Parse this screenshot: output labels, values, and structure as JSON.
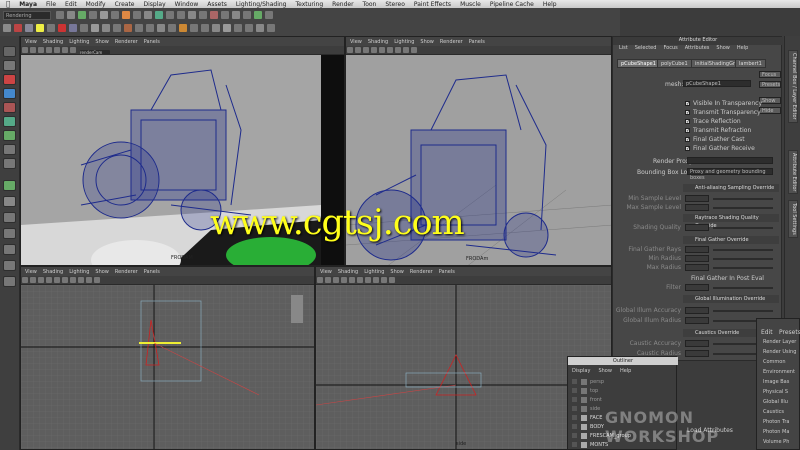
{
  "menubar": {
    "items": [
      "Maya",
      "File",
      "Edit",
      "Modify",
      "Create",
      "Display",
      "Window",
      "Assets",
      "Lighting/Shading",
      "Texturing",
      "Render",
      "Toon",
      "Stereo",
      "Paint Effects",
      "Muscle",
      "Pipeline Cache",
      "Help"
    ]
  },
  "shelf": {
    "mode": "Rendering"
  },
  "viewports": {
    "top_left": {
      "menu": [
        "View",
        "Shading",
        "Lighting",
        "Show",
        "Renderer",
        "Panels"
      ],
      "camera": "renderCam",
      "label": "FRODAM"
    },
    "top_right": {
      "menu": [
        "View",
        "Shading",
        "Lighting",
        "Show",
        "Renderer",
        "Panels"
      ],
      "label": "FRODAm"
    },
    "bottom_left": {
      "menu": [
        "View",
        "Shading",
        "Lighting",
        "Show",
        "Renderer",
        "Panels"
      ]
    },
    "bottom_right": {
      "menu": [
        "View",
        "Shading",
        "Lighting",
        "Show",
        "Renderer",
        "Panels"
      ],
      "label": "side"
    }
  },
  "attribute_editor": {
    "title": "Attribute Editor",
    "menu": [
      "List",
      "Selected",
      "Focus",
      "Attributes",
      "Show",
      "Help"
    ],
    "tabs": [
      "pCubeShape1",
      "polyCube1",
      "initialShadingGroup",
      "lambert1"
    ],
    "mesh_label": "mesh:",
    "mesh_value": "pCubeShape1",
    "buttons": [
      "Focus",
      "Presets",
      "Show",
      "Hide"
    ],
    "checks": [
      {
        "label": "Visible In Transparency",
        "checked": true
      },
      {
        "label": "Transmit Transparency",
        "checked": true
      },
      {
        "label": "Trace Reflection",
        "checked": true
      },
      {
        "label": "Transmit Refraction",
        "checked": true
      },
      {
        "label": "Final Gather Cast",
        "checked": true
      },
      {
        "label": "Final Gather Receive",
        "checked": true
      }
    ],
    "render_proxy_label": "Render Proxy",
    "bbox_label": "Bounding Box Loaders",
    "bbox_value": "Proxy and geometry bounding boxes",
    "sections": [
      "Anti-aliasing Sampling Override",
      "Raytrace Shading Quality Override",
      "Final Gather Override",
      "Global Illumination Override",
      "Caustics Override"
    ],
    "fields": [
      "Min Sample Level",
      "Max Sample Level",
      "Shading Quality",
      "Final Gather Rays",
      "Min Radius",
      "Max Radius",
      "Filter",
      "Global Illum Accuracy",
      "Global Illum Radius",
      "Caustic Accuracy",
      "Caustic Radius"
    ],
    "fg_check": "Final Gather In Post Eval",
    "load_label": "Load Attributes"
  },
  "side_tabs": [
    "Channel Box / Layer Editor",
    "Attribute Editor",
    "Tool Settings"
  ],
  "outliner": {
    "title": "Outliner",
    "menu": [
      "Display",
      "Show",
      "Help"
    ],
    "rows": [
      "persp",
      "top",
      "front",
      "side",
      "FACE",
      "BODY",
      "FRESCAM_group",
      "MONTS"
    ]
  },
  "ae2": {
    "menu": [
      "Edit",
      "Presets"
    ],
    "rows": [
      "Render Layer",
      "Render Using",
      "Common",
      "Environment",
      "Image Bas",
      "Physical S",
      "Global Illu",
      "Caustics",
      "Photon Tra",
      "Photon Ma",
      "Volume Ph"
    ]
  },
  "watermark": "www.cgtsj.com",
  "gnomon": "GNOMON WORKSHOP",
  "colors": {
    "wire": "#1e2b8c",
    "watermark": "#ffff1a",
    "selected_green": "#2bbf3a"
  }
}
